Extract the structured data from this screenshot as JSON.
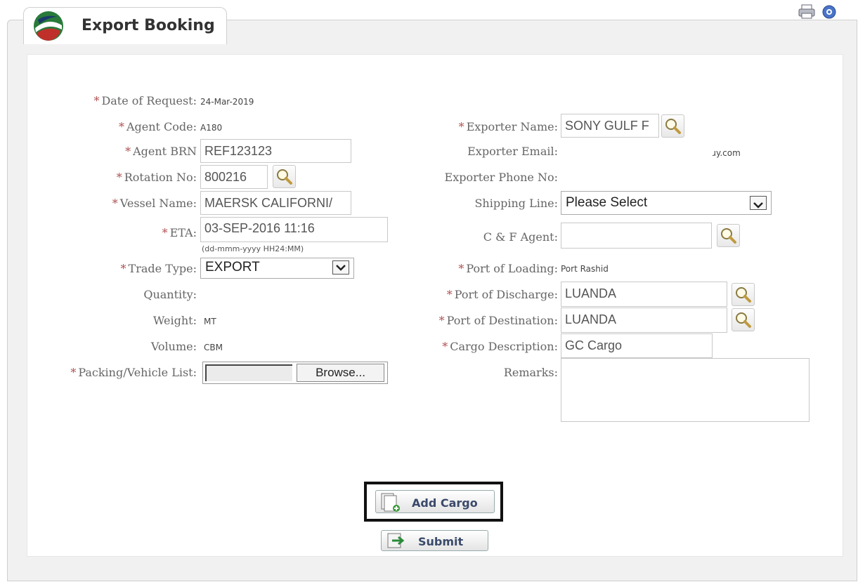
{
  "header": {
    "title": "Export Booking"
  },
  "icons": {
    "logo": "uae-logo-icon",
    "print": "print-icon",
    "help": "help-icon",
    "search": "magnifier-icon"
  },
  "form": {
    "date_of_request": {
      "label": "Date of Request:",
      "value": "24-Mar-2019"
    },
    "agent_code": {
      "label": "Agent Code:",
      "value": "A180"
    },
    "agent_brn": {
      "label": "Agent BRN",
      "value": "REF123123"
    },
    "rotation_no": {
      "label": "Rotation No:",
      "value": "800216"
    },
    "vessel_name": {
      "label": "Vessel Name:",
      "value": "MAERSK CALIFORNI/"
    },
    "eta": {
      "label": "ETA:",
      "value": "03-SEP-2016 11:16",
      "hint": "(dd-mmm-yyyy HH24:MM)"
    },
    "trade_type": {
      "label": "Trade Type:",
      "value": "EXPORT"
    },
    "quantity": {
      "label": "Quantity:",
      "value": ""
    },
    "weight": {
      "label": "Weight:",
      "value": "MT"
    },
    "volume": {
      "label": "Volume:",
      "value": "CBM"
    },
    "packing_list": {
      "label": "Packing/Vehicle List:",
      "browse": "Browse..."
    },
    "exporter_name": {
      "label": "Exporter Name:",
      "value": "SONY GULF F"
    },
    "exporter_email": {
      "label": "Exporter Email:",
      "value": "ɹy.com"
    },
    "exporter_phone": {
      "label": "Exporter Phone No:",
      "value": ""
    },
    "shipping_line": {
      "label": "Shipping Line:",
      "value": "Please Select"
    },
    "cf_agent": {
      "label": "C & F Agent:",
      "value": ""
    },
    "port_of_loading": {
      "label": "Port of Loading:",
      "value": "Port Rashid"
    },
    "port_of_discharge": {
      "label": "Port of Discharge:",
      "value": "LUANDA"
    },
    "port_of_destination": {
      "label": "Port of Destination:",
      "value": "LUANDA"
    },
    "cargo_description": {
      "label": "Cargo Description:",
      "value": "GC Cargo"
    },
    "remarks": {
      "label": "Remarks:",
      "value": ""
    },
    "required_mark": "*"
  },
  "actions": {
    "add_cargo": "Add Cargo",
    "submit": "Submit"
  }
}
